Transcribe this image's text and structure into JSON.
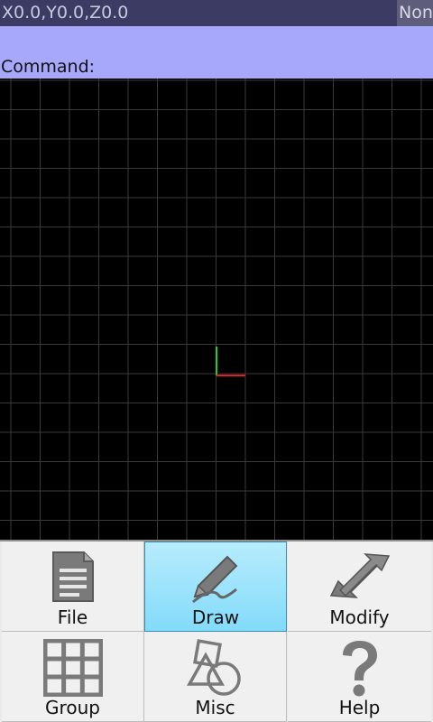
{
  "status": {
    "coordinates": "X0.0,Y0.0,Z0.0",
    "snap_mode": "Non"
  },
  "command": {
    "label": "Command:"
  },
  "menu": {
    "items": [
      {
        "label": "File",
        "icon": "document-icon",
        "selected": false
      },
      {
        "label": "Draw",
        "icon": "pencil-icon",
        "selected": true
      },
      {
        "label": "Modify",
        "icon": "arrows-icon",
        "selected": false
      },
      {
        "label": "Group",
        "icon": "grid-icon",
        "selected": false
      },
      {
        "label": "Misc",
        "icon": "shapes-icon",
        "selected": false
      },
      {
        "label": "Help",
        "icon": "question-mark-icon",
        "selected": false
      }
    ]
  },
  "colors": {
    "status_bar": "#3b3b63",
    "command_bar": "#a7a8fc",
    "canvas": "#000000",
    "grid": "#3a3a3a",
    "x_axis": "#e02020",
    "y_axis": "#20d020",
    "selected_menu": "#83dbfa"
  }
}
